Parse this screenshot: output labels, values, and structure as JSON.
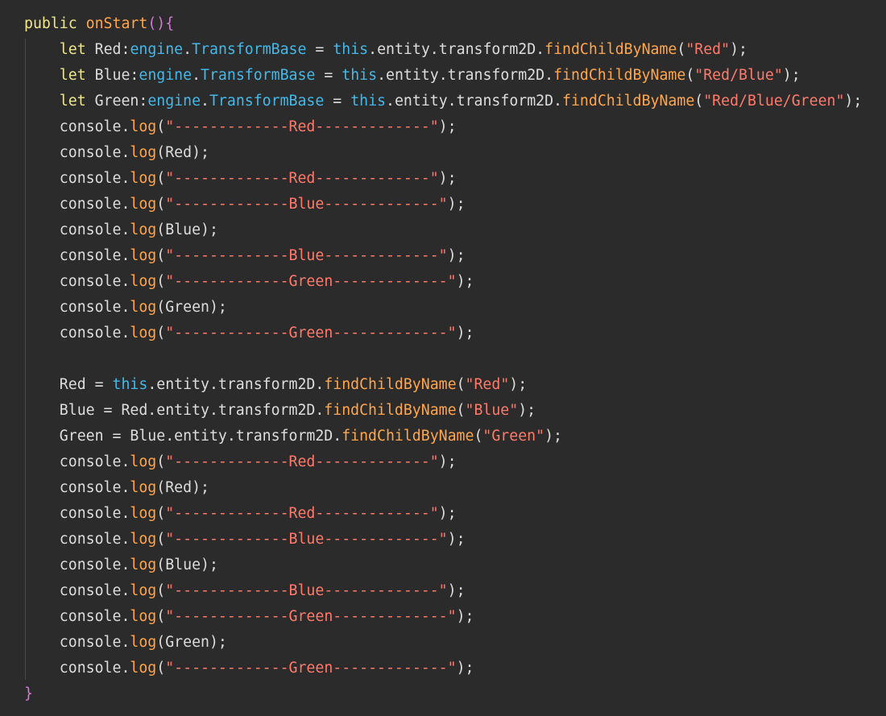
{
  "colors": {
    "background": "#2b2b2b",
    "keyword": "#f0e68c",
    "function": "#ffa64d",
    "type": "#45b8e8",
    "plain": "#dddddd",
    "string": "#ff7a6b",
    "bracket_outer": "#d17ad6"
  },
  "code": {
    "lines": [
      [
        {
          "c": "kw",
          "t": "public "
        },
        {
          "c": "fn",
          "t": "onStart"
        },
        {
          "c": "br2",
          "t": "(){"
        }
      ],
      [
        {
          "c": "pl",
          "t": "    "
        },
        {
          "c": "kw",
          "t": "let "
        },
        {
          "c": "pl",
          "t": "Red:"
        },
        {
          "c": "ty",
          "t": "engine"
        },
        {
          "c": "pl",
          "t": "."
        },
        {
          "c": "ty",
          "t": "TransformBase"
        },
        {
          "c": "pl",
          "t": " = "
        },
        {
          "c": "ty",
          "t": "this"
        },
        {
          "c": "pl",
          "t": ".entity.transform2D."
        },
        {
          "c": "fn",
          "t": "findChildByName"
        },
        {
          "c": "pl",
          "t": "("
        },
        {
          "c": "st",
          "t": "\"Red\""
        },
        {
          "c": "pl",
          "t": ");"
        }
      ],
      [
        {
          "c": "pl",
          "t": "    "
        },
        {
          "c": "kw",
          "t": "let "
        },
        {
          "c": "pl",
          "t": "Blue:"
        },
        {
          "c": "ty",
          "t": "engine"
        },
        {
          "c": "pl",
          "t": "."
        },
        {
          "c": "ty",
          "t": "TransformBase"
        },
        {
          "c": "pl",
          "t": " = "
        },
        {
          "c": "ty",
          "t": "this"
        },
        {
          "c": "pl",
          "t": ".entity.transform2D."
        },
        {
          "c": "fn",
          "t": "findChildByName"
        },
        {
          "c": "pl",
          "t": "("
        },
        {
          "c": "st",
          "t": "\"Red/Blue\""
        },
        {
          "c": "pl",
          "t": ");"
        }
      ],
      [
        {
          "c": "pl",
          "t": "    "
        },
        {
          "c": "kw",
          "t": "let "
        },
        {
          "c": "pl",
          "t": "Green:"
        },
        {
          "c": "ty",
          "t": "engine"
        },
        {
          "c": "pl",
          "t": "."
        },
        {
          "c": "ty",
          "t": "TransformBase"
        },
        {
          "c": "pl",
          "t": " = "
        },
        {
          "c": "ty",
          "t": "this"
        },
        {
          "c": "pl",
          "t": ".entity.transform2D."
        },
        {
          "c": "fn",
          "t": "findChildByName"
        },
        {
          "c": "pl",
          "t": "("
        },
        {
          "c": "st",
          "t": "\"Red/Blue/Green\""
        },
        {
          "c": "pl",
          "t": ");"
        }
      ],
      [
        {
          "c": "pl",
          "t": "    console."
        },
        {
          "c": "fn",
          "t": "log"
        },
        {
          "c": "pl",
          "t": "("
        },
        {
          "c": "st",
          "t": "\"-------------Red-------------\""
        },
        {
          "c": "pl",
          "t": ");"
        }
      ],
      [
        {
          "c": "pl",
          "t": "    console."
        },
        {
          "c": "fn",
          "t": "log"
        },
        {
          "c": "pl",
          "t": "(Red);"
        }
      ],
      [
        {
          "c": "pl",
          "t": "    console."
        },
        {
          "c": "fn",
          "t": "log"
        },
        {
          "c": "pl",
          "t": "("
        },
        {
          "c": "st",
          "t": "\"-------------Red-------------\""
        },
        {
          "c": "pl",
          "t": ");"
        }
      ],
      [
        {
          "c": "pl",
          "t": "    console."
        },
        {
          "c": "fn",
          "t": "log"
        },
        {
          "c": "pl",
          "t": "("
        },
        {
          "c": "st",
          "t": "\"-------------Blue-------------\""
        },
        {
          "c": "pl",
          "t": ");"
        }
      ],
      [
        {
          "c": "pl",
          "t": "    console."
        },
        {
          "c": "fn",
          "t": "log"
        },
        {
          "c": "pl",
          "t": "(Blue);"
        }
      ],
      [
        {
          "c": "pl",
          "t": "    console."
        },
        {
          "c": "fn",
          "t": "log"
        },
        {
          "c": "pl",
          "t": "("
        },
        {
          "c": "st",
          "t": "\"-------------Blue-------------\""
        },
        {
          "c": "pl",
          "t": ");"
        }
      ],
      [
        {
          "c": "pl",
          "t": "    console."
        },
        {
          "c": "fn",
          "t": "log"
        },
        {
          "c": "pl",
          "t": "("
        },
        {
          "c": "st",
          "t": "\"-------------Green-------------\""
        },
        {
          "c": "pl",
          "t": ");"
        }
      ],
      [
        {
          "c": "pl",
          "t": "    console."
        },
        {
          "c": "fn",
          "t": "log"
        },
        {
          "c": "pl",
          "t": "(Green);"
        }
      ],
      [
        {
          "c": "pl",
          "t": "    console."
        },
        {
          "c": "fn",
          "t": "log"
        },
        {
          "c": "pl",
          "t": "("
        },
        {
          "c": "st",
          "t": "\"-------------Green-------------\""
        },
        {
          "c": "pl",
          "t": ");"
        }
      ],
      [
        {
          "c": "pl",
          "t": ""
        }
      ],
      [
        {
          "c": "pl",
          "t": "    Red = "
        },
        {
          "c": "ty",
          "t": "this"
        },
        {
          "c": "pl",
          "t": ".entity.transform2D."
        },
        {
          "c": "fn",
          "t": "findChildByName"
        },
        {
          "c": "pl",
          "t": "("
        },
        {
          "c": "st",
          "t": "\"Red\""
        },
        {
          "c": "pl",
          "t": ");"
        }
      ],
      [
        {
          "c": "pl",
          "t": "    Blue = Red.entity.transform2D."
        },
        {
          "c": "fn",
          "t": "findChildByName"
        },
        {
          "c": "pl",
          "t": "("
        },
        {
          "c": "st",
          "t": "\"Blue\""
        },
        {
          "c": "pl",
          "t": ");"
        }
      ],
      [
        {
          "c": "pl",
          "t": "    Green = Blue.entity.transform2D."
        },
        {
          "c": "fn",
          "t": "findChildByName"
        },
        {
          "c": "pl",
          "t": "("
        },
        {
          "c": "st",
          "t": "\"Green\""
        },
        {
          "c": "pl",
          "t": ");"
        }
      ],
      [
        {
          "c": "pl",
          "t": "    console."
        },
        {
          "c": "fn",
          "t": "log"
        },
        {
          "c": "pl",
          "t": "("
        },
        {
          "c": "st",
          "t": "\"-------------Red-------------\""
        },
        {
          "c": "pl",
          "t": ");"
        }
      ],
      [
        {
          "c": "pl",
          "t": "    console."
        },
        {
          "c": "fn",
          "t": "log"
        },
        {
          "c": "pl",
          "t": "(Red);"
        }
      ],
      [
        {
          "c": "pl",
          "t": "    console."
        },
        {
          "c": "fn",
          "t": "log"
        },
        {
          "c": "pl",
          "t": "("
        },
        {
          "c": "st",
          "t": "\"-------------Red-------------\""
        },
        {
          "c": "pl",
          "t": ");"
        }
      ],
      [
        {
          "c": "pl",
          "t": "    console."
        },
        {
          "c": "fn",
          "t": "log"
        },
        {
          "c": "pl",
          "t": "("
        },
        {
          "c": "st",
          "t": "\"-------------Blue-------------\""
        },
        {
          "c": "pl",
          "t": ");"
        }
      ],
      [
        {
          "c": "pl",
          "t": "    console."
        },
        {
          "c": "fn",
          "t": "log"
        },
        {
          "c": "pl",
          "t": "(Blue);"
        }
      ],
      [
        {
          "c": "pl",
          "t": "    console."
        },
        {
          "c": "fn",
          "t": "log"
        },
        {
          "c": "pl",
          "t": "("
        },
        {
          "c": "st",
          "t": "\"-------------Blue-------------\""
        },
        {
          "c": "pl",
          "t": ");"
        }
      ],
      [
        {
          "c": "pl",
          "t": "    console."
        },
        {
          "c": "fn",
          "t": "log"
        },
        {
          "c": "pl",
          "t": "("
        },
        {
          "c": "st",
          "t": "\"-------------Green-------------\""
        },
        {
          "c": "pl",
          "t": ");"
        }
      ],
      [
        {
          "c": "pl",
          "t": "    console."
        },
        {
          "c": "fn",
          "t": "log"
        },
        {
          "c": "pl",
          "t": "(Green);"
        }
      ],
      [
        {
          "c": "pl",
          "t": "    console."
        },
        {
          "c": "fn",
          "t": "log"
        },
        {
          "c": "pl",
          "t": "("
        },
        {
          "c": "st",
          "t": "\"-------------Green-------------\""
        },
        {
          "c": "pl",
          "t": ");"
        }
      ],
      [
        {
          "c": "br2",
          "t": "}"
        }
      ]
    ]
  }
}
